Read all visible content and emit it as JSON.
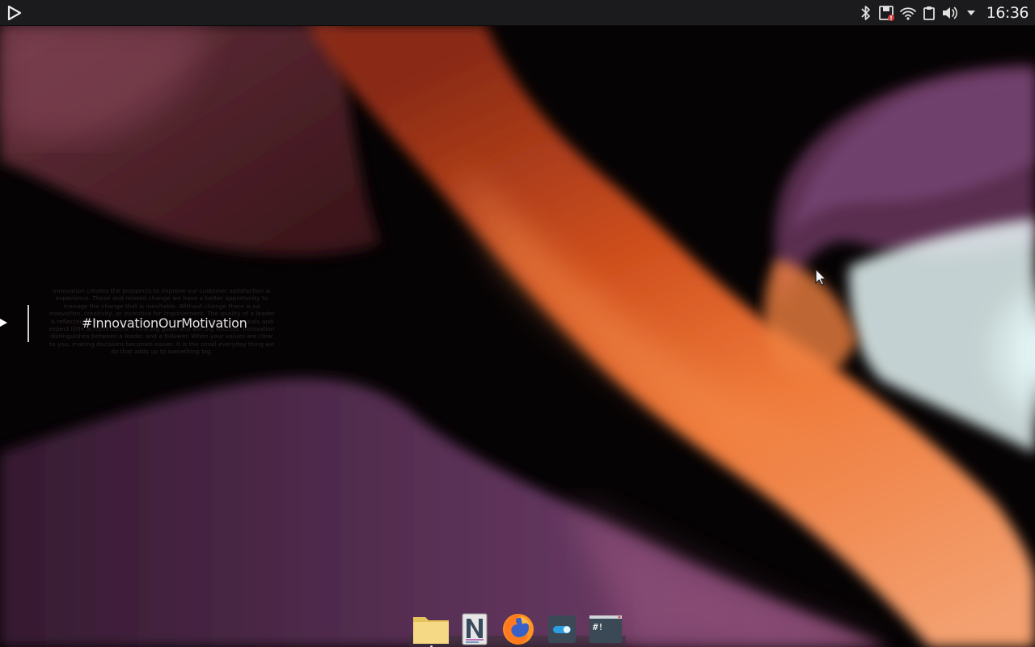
{
  "top_panel": {
    "clock": "16:36",
    "tray_icons": [
      "bluetooth-icon",
      "drive-icon",
      "wifi-icon",
      "clipboard-icon",
      "volume-icon",
      "menu-dropdown-icon"
    ]
  },
  "widget": {
    "hashtag": "#InnovationOurMotivation",
    "body_text": "Innovation creates the prospects to improve our customer satisfaction & experience. These and related change we have a better opportunity to manage the change that is inevitable. Without change there is no innovation, creativity, or incentive for improvement. The quality of a leader is reflected in the standards they set for themselves. Think little goals and expect little achievements. Think big goals and win big success. Innovation distinguishes between a leader and a follower. When your values are clear to you, making decisions becomes easier. It is the small everyday thing we do that adds up to something big."
  },
  "dock": {
    "items": [
      "file-manager",
      "text-editor",
      "firefox",
      "settings",
      "terminal"
    ],
    "terminal_label": "#!"
  },
  "colors": {
    "panel": "#1b1b1d",
    "clock_text": "#f0f0f0",
    "wallpaper_orange": "#e8662a",
    "wallpaper_purple": "#5a3258"
  }
}
